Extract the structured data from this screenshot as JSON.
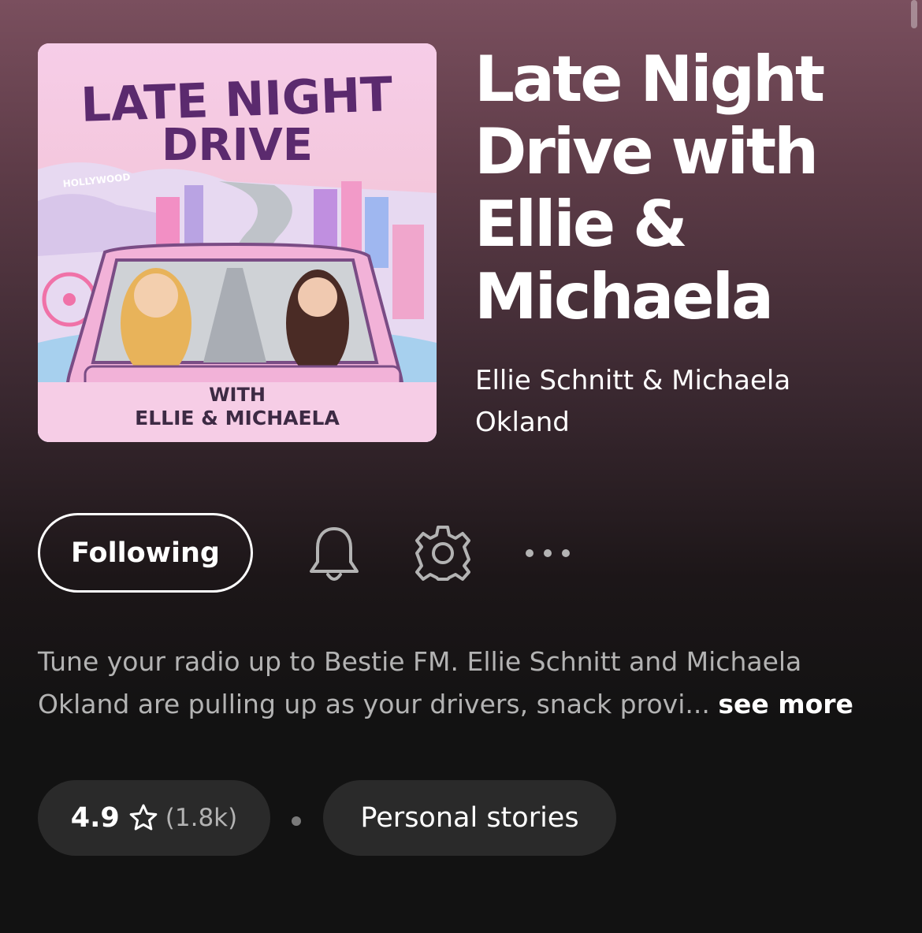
{
  "podcast": {
    "cover": {
      "title_line1": "LATE NIGHT",
      "title_line2": "DRIVE",
      "hollywood_sign": "HOLLYWOOD",
      "footer_line1": "WITH",
      "footer_line2": "ELLIE & MICHAELA"
    },
    "title": "Late Night Drive with Ellie & Michaela",
    "authors": "Ellie Schnitt & Michaela Okland",
    "description": "Tune your radio up to Bestie FM. Ellie Schnitt and Michaela Okland are pulling up as your drivers, snack provi...",
    "see_more_label": "see more"
  },
  "actions": {
    "follow_label": "Following",
    "bell_icon": "bell-icon",
    "settings_icon": "gear-icon",
    "more_icon": "more-options-icon"
  },
  "meta": {
    "rating": "4.9",
    "rating_icon": "star-outline-icon",
    "rating_count": "(1.8k)",
    "category": "Personal stories"
  },
  "colors": {
    "accent_text": "#ffffff",
    "muted_text": "#b3b3b3",
    "chip_bg": "#2a2a2a",
    "cover_title": "#5b2a6e"
  }
}
